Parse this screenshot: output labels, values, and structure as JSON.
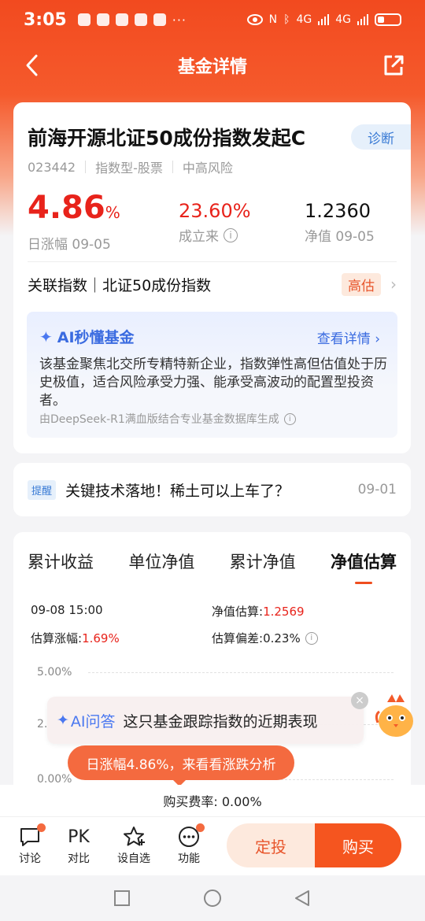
{
  "status_bar": {
    "time": "3:05",
    "network1": "4G",
    "network2": "4G"
  },
  "header": {
    "title": "基金详情"
  },
  "fund": {
    "name": "前海开源北证50成份指数发起C",
    "diagnose_label": "诊断",
    "code": "023442",
    "type": "指数型-股票",
    "risk": "中高风险",
    "daily_change_value": "4.86",
    "daily_change_unit": "%",
    "daily_change_label": "日涨幅 09-05",
    "since_inception_value": "23.60%",
    "since_inception_label": "成立来",
    "nav_value": "1.2360",
    "nav_label": "净值 09-05",
    "related_index": "关联指数｜北证50成份指数",
    "valuation_tag": "高估"
  },
  "ai_summary": {
    "title": "AI秒懂基金",
    "link": "查看详情",
    "body": "该基金聚焦北交所专精特新企业，指数弹性高但估值处于历史极值，适合风险承受力强、能承受高波动的配置型投资者。",
    "footer": "由DeepSeek-R1满血版结合专业基金数据库生成"
  },
  "news": {
    "tag": "提醒",
    "text": "关键技术落地！稀土可以上车了？",
    "date": "09-01"
  },
  "chart_tabs": [
    "累计收益",
    "单位净值",
    "累计净值",
    "净值估算"
  ],
  "estimate": {
    "datetime": "09-08 15:00",
    "nav_est_label": "净值估算:",
    "nav_est_value": "1.2569",
    "change_label": "估算涨幅:",
    "change_value": "1.69%",
    "deviation_label": "估算偏差:",
    "deviation_value": "0.23%"
  },
  "chart_axis": {
    "top": "5.00%",
    "mid": "2.",
    "bottom": "0.00%"
  },
  "ai_ask": {
    "tag": "AI问答",
    "text": "这只基金跟踪指数的近期表现"
  },
  "analysis_pill": "日涨幅4.86%，来看看涨跌分析",
  "fee": "购买费率: 0.00%",
  "bottom_nav": {
    "discuss": "讨论",
    "compare_icon": "PK",
    "compare": "对比",
    "watchlist": "设自选",
    "functions": "功能",
    "dingtou": "定投",
    "buy": "购买"
  },
  "colors": {
    "brand": "#f24a1f",
    "up": "#e8231b",
    "link": "#3a6be0"
  }
}
